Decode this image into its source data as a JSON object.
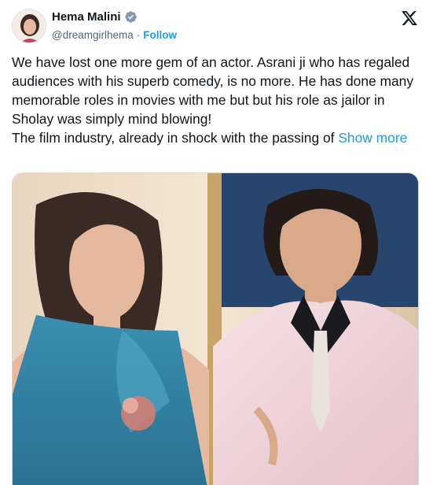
{
  "author": {
    "name": "Hema Malini",
    "handle": "@dreamgirlhema",
    "separator": "·",
    "follow_label": "Follow",
    "verified": true
  },
  "platform_icon": "x-logo-icon",
  "tweet": {
    "line1": "We have lost one more gem of an actor. Asrani ji who has regaled audiences with his superb comedy, is no more. He has done many memorable roles in movies with me but but his role as jailor in Sholay was simply mind blowing!",
    "line2": "The film industry, already in shock with the passing of",
    "show_more_label": "Show more"
  },
  "media": {
    "type": "photo",
    "icon": "photo"
  },
  "colors": {
    "accent": "#1d9bf0",
    "text": "#0f1419",
    "muted": "#536471"
  }
}
